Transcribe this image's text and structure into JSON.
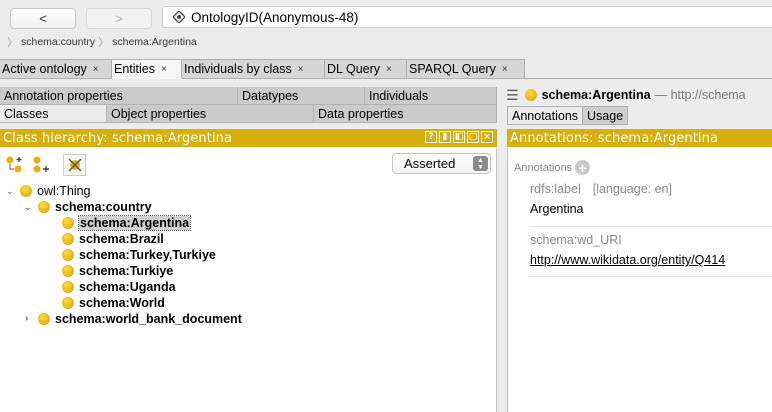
{
  "nav": {
    "back_label": "<",
    "forward_label": ">"
  },
  "ontology": {
    "id_label": "OntologyID(Anonymous-48)"
  },
  "breadcrumb": [
    "schema:country",
    "schema:Argentina"
  ],
  "main_tabs": [
    {
      "label": "Active ontology",
      "active": false
    },
    {
      "label": "Entities",
      "active": true
    },
    {
      "label": "Individuals by class",
      "active": false
    },
    {
      "label": "DL Query",
      "active": false
    },
    {
      "label": "SPARQL Query",
      "active": false
    }
  ],
  "tab_close_glyph": "×",
  "sub_tabs_row1": [
    "Annotation properties",
    "Datatypes",
    "Individuals"
  ],
  "sub_tabs_row2": [
    "Classes",
    "Object properties",
    "Data properties"
  ],
  "class_hierarchy": {
    "header": "Class hierarchy: schema:Argentina",
    "mode": "Asserted",
    "tree": {
      "root": "owl:Thing",
      "country": "schema:country",
      "children": [
        "schema:Argentina",
        "schema:Brazil",
        "schema:Turkey,Turkiye",
        "schema:Turkiye",
        "schema:Uganda",
        "schema:World"
      ],
      "other": "schema:world_bank_document"
    }
  },
  "right": {
    "entity_title": "schema:Argentina",
    "entity_suffix": "— http://schema",
    "tabs": [
      "Annotations",
      "Usage"
    ],
    "header": "Annotations: schema:Argentina",
    "annotations_label": "Annotations",
    "items": [
      {
        "property": "rdfs:label",
        "lang": "[language: en]",
        "value": "Argentina"
      },
      {
        "property": "schema:wd_URI",
        "lang": "",
        "value": "http://www.wikidata.org/entity/Q414"
      }
    ]
  },
  "colors": {
    "header_bar": "#d7af0e",
    "class_dot": "#e3b20c"
  }
}
